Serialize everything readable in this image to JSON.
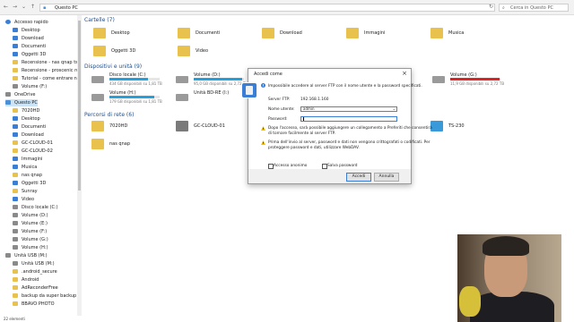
{
  "titlebar": {
    "address": "Questo PC",
    "search_placeholder": "Cerca in Questo PC"
  },
  "sidebar": {
    "items": [
      {
        "label": "Accesso rapido",
        "icon": "star-icon"
      },
      {
        "label": "Desktop",
        "icon": "desktop-icon"
      },
      {
        "label": "Download",
        "icon": "download-icon"
      },
      {
        "label": "Documenti",
        "icon": "documents-icon"
      },
      {
        "label": "Oggetti 3D",
        "icon": "objects3d-icon"
      },
      {
        "label": "Recensione - nas qnap ts 230",
        "icon": "folder-icon"
      },
      {
        "label": "Recensione - proscenic robot",
        "icon": "folder-icon"
      },
      {
        "label": "Tutorial - come entrare nel nas",
        "icon": "folder-icon"
      },
      {
        "label": "Volume (F:)",
        "icon": "drive-icon"
      },
      {
        "label": "OneDrive",
        "icon": "onedrive-icon"
      },
      {
        "label": "Questo PC",
        "icon": "pc-icon"
      },
      {
        "label": "7020HD",
        "icon": "folder-icon"
      },
      {
        "label": "Desktop",
        "icon": "desktop-icon"
      },
      {
        "label": "Documenti",
        "icon": "documents-icon"
      },
      {
        "label": "Download",
        "icon": "download-icon"
      },
      {
        "label": "GC-CLOUD-01",
        "icon": "folder-icon"
      },
      {
        "label": "GC-CLOUD-02",
        "icon": "folder-icon"
      },
      {
        "label": "Immagini",
        "icon": "pictures-icon"
      },
      {
        "label": "Musica",
        "icon": "music-icon"
      },
      {
        "label": "nas qnap",
        "icon": "folder-icon"
      },
      {
        "label": "Oggetti 3D",
        "icon": "objects3d-icon"
      },
      {
        "label": "Sunray",
        "icon": "folder-icon"
      },
      {
        "label": "Video",
        "icon": "video-icon"
      },
      {
        "label": "Disco locale (C:)",
        "icon": "drive-icon"
      },
      {
        "label": "Volume (D:)",
        "icon": "drive-icon"
      },
      {
        "label": "Volume (E:)",
        "icon": "drive-icon"
      },
      {
        "label": "Volume (F:)",
        "icon": "drive-icon"
      },
      {
        "label": "Volume (G:)",
        "icon": "drive-icon"
      },
      {
        "label": "Volume (H:)",
        "icon": "drive-icon"
      },
      {
        "label": "Unità USB (M:)",
        "icon": "usb-icon"
      },
      {
        "label": "Unità USB (M:)",
        "icon": "usb-icon"
      },
      {
        "label": ".android_secure",
        "icon": "folder-icon"
      },
      {
        "label": "Android",
        "icon": "folder-icon"
      },
      {
        "label": "AdReconderFree",
        "icon": "folder-icon"
      },
      {
        "label": "backup da super backup app",
        "icon": "folder-icon"
      },
      {
        "label": "BBAVO PHOTO",
        "icon": "folder-icon"
      }
    ]
  },
  "main": {
    "folders_header": "Cartelle (7)",
    "folders": [
      {
        "label": "Desktop",
        "icon": "desktop-icon"
      },
      {
        "label": "Documenti",
        "icon": "documents-icon"
      },
      {
        "label": "Download",
        "icon": "download-icon"
      },
      {
        "label": "Immagini",
        "icon": "pictures-icon"
      },
      {
        "label": "Musica",
        "icon": "music-icon"
      },
      {
        "label": "Oggetti 3D",
        "icon": "objects3d-icon"
      },
      {
        "label": "Video",
        "icon": "video-icon"
      }
    ],
    "devices_header": "Dispositivi e unità (9)",
    "drives": [
      {
        "label": "Disco locale (C:)",
        "free": "434 GB disponibili su 1,81 TB",
        "fill": 0.77,
        "color": "#26a0da"
      },
      {
        "label": "Volume (D:)",
        "free": "95,0 GB disponibili su 2,72 T",
        "fill": 0.97,
        "color": "#26a0da"
      },
      {
        "label": "Volume (G:)",
        "free": "11,9 GB disponibili su 2,72 TB",
        "fill": 0.99,
        "color": "#da2626"
      },
      {
        "label": "Volume (H:)",
        "free": "179 GB disponibili su 1,81 TB",
        "fill": 0.9,
        "color": "#26a0da"
      },
      {
        "label": "Unità BD-RE (I:)",
        "free": "",
        "fill": 0,
        "color": "#26a0da"
      }
    ],
    "network_header": "Percorsi di rete (6)",
    "network": [
      {
        "label": "7020HD",
        "icon": "media-server-icon"
      },
      {
        "label": "GC-CLOUD-01",
        "icon": "network-drive-icon"
      },
      {
        "label": "TS-230",
        "icon": "nas-icon"
      },
      {
        "label": "nas qnap",
        "icon": "media-server-icon"
      }
    ]
  },
  "dialog": {
    "title": "Accedi come",
    "message": "Impossibile accedere al server FTP con il nome utente e la password specificati.",
    "server_label": "Server FTP:",
    "server_value": "192.168.1.160",
    "user_label": "Nome utente:",
    "user_value": "admin",
    "password_label": "Password:",
    "password_value": "",
    "info_text_1": "Dopo l'accesso, sarà possibile aggiungere un collegamento a Preferiti che consentirà",
    "info_text_2": "di tornare facilmente al server FTP.",
    "warn_text_1": "Prima dell'invio al server, password e dati non vengono crittografati o codificati. Per",
    "warn_text_2": "proteggere password e dati, utilizzare WebDAV.",
    "anon_label": "Accesso anonimo",
    "save_label": "Salva password",
    "ok_label": "Accedi",
    "cancel_label": "Annulla"
  },
  "status": {
    "count": "22 elementi"
  }
}
